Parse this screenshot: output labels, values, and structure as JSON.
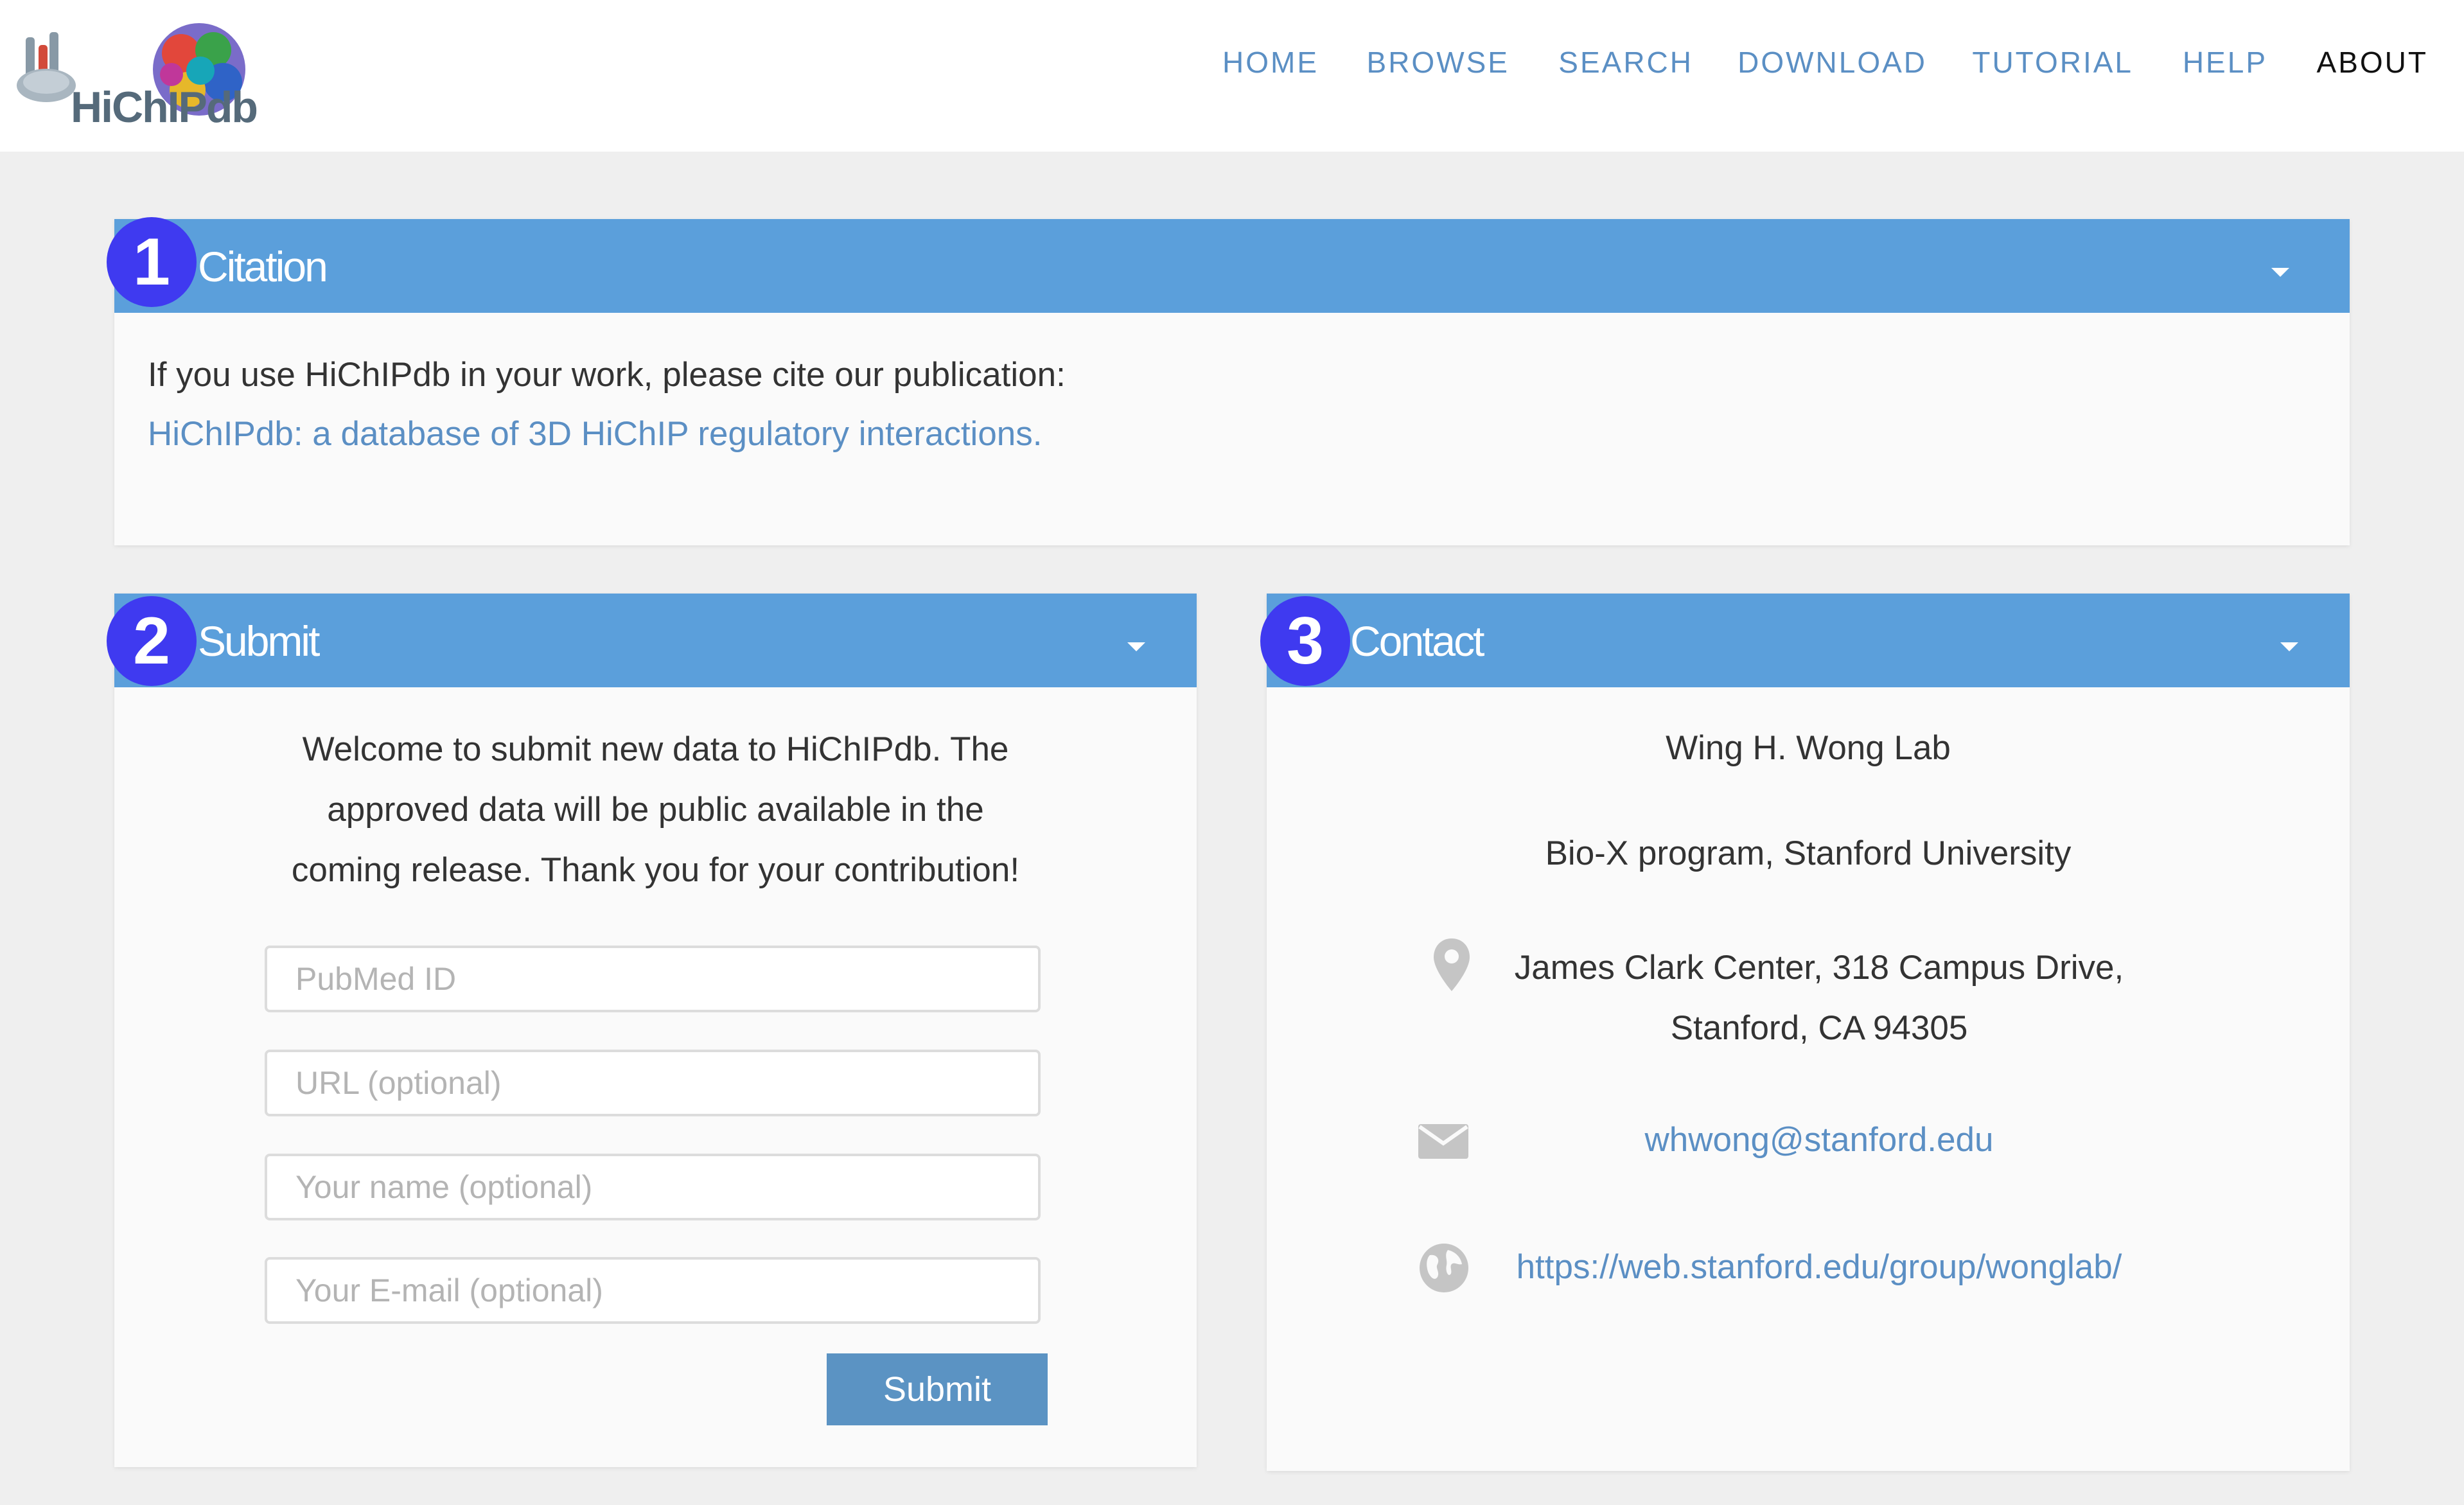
{
  "header": {
    "logo_text": "HiChIPdb",
    "nav": [
      "HOME",
      "BROWSE",
      "SEARCH",
      "DOWNLOAD",
      "TUTORIAL",
      "HELP",
      "ABOUT"
    ],
    "active_nav": "ABOUT"
  },
  "citation": {
    "badge": "1",
    "title": "Citation",
    "intro": "If you use HiChIPdb in your work, please cite our publication:",
    "link": "HiChIPdb: a database of 3D HiChIP regulatory interactions."
  },
  "submit": {
    "badge": "2",
    "title": "Submit",
    "intro_lines": [
      "Welcome to submit new data to HiChIPdb. The",
      "approved data will be public available in the",
      "coming release. Thank you for your contribution!"
    ],
    "fields": {
      "pubmed": "PubMed ID",
      "url": "URL (optional)",
      "name": "Your name (optional)",
      "email": "Your E-mail (optional)"
    },
    "button": "Submit"
  },
  "contact": {
    "badge": "3",
    "title": "Contact",
    "lab": "Wing H. Wong Lab",
    "program": "Bio-X program, Stanford University",
    "address_line1": "James Clark Center, 318 Campus Drive,",
    "address_line2": "Stanford, CA 94305",
    "email": "whwong@stanford.edu",
    "website": "https://web.stanford.edu/group/wonglab/"
  },
  "colors": {
    "panel_header": "#5b9fdb",
    "badge": "#3f3af0",
    "link": "#5b8fc4",
    "button": "#5b93c3"
  }
}
